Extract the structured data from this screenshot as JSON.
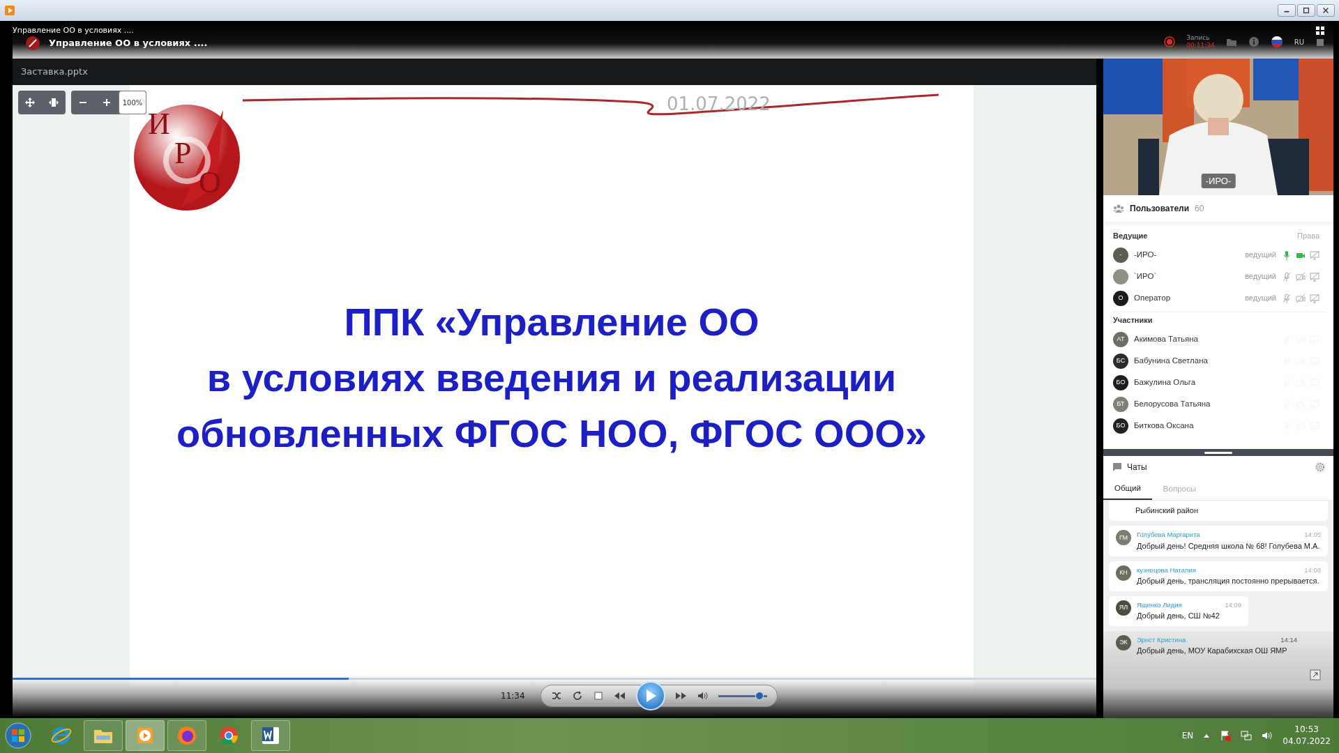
{
  "window": {
    "caption": "Управление ОО в условиях ...."
  },
  "header": {
    "title": "Управление ОО в условиях ....",
    "record_label": "Запись",
    "record_time": "00:11:34",
    "language": "RU"
  },
  "presentation": {
    "file": "Заставка.pptx",
    "zoom": "100%",
    "date": "01.07.2022",
    "logo_letters": [
      "И",
      "Р",
      "О"
    ],
    "title_lines": [
      "ППК «Управление ОО",
      "в условиях введения и реализации",
      "обновленных ФГОС НОО, ФГОС ООО»"
    ]
  },
  "video": {
    "kind": "picture",
    "caption": "-ИРО-"
  },
  "users": {
    "title": "Пользователи",
    "count": "60",
    "rights_label": "Права",
    "groups": [
      {
        "title": "Ведущие",
        "members": [
          {
            "initials": "-",
            "name": "-ИРО-",
            "role": "ведущий",
            "active": true,
            "mic": true,
            "cam": true,
            "color": "#5b5e50"
          },
          {
            "name": "`ИРО`",
            "role": "ведущий",
            "active": true,
            "mic": false,
            "cam": false,
            "color": "#8c9183"
          },
          {
            "initials": "О",
            "name": "Оператор",
            "role": "ведущий",
            "active": true,
            "mic": false,
            "cam": false,
            "color": "#1b1b1b"
          }
        ]
      },
      {
        "title": "Участники",
        "members": [
          {
            "initials": "АТ",
            "name": "Акимова Татьяна",
            "active": false,
            "mic": false,
            "cam": false,
            "color": "#6b6f62"
          },
          {
            "initials": "БС",
            "name": "Бабунина Светлана",
            "active": false,
            "mic": false,
            "cam": false,
            "color": "#2b2b2b"
          },
          {
            "initials": "БО",
            "name": "Бажулина Ольга",
            "active": false,
            "mic": false,
            "cam": false,
            "color": "#1e1e1e"
          },
          {
            "initials": "БТ",
            "name": "Белорусова Татьяна",
            "active": false,
            "mic": false,
            "cam": false,
            "color": "#7d8274"
          },
          {
            "initials": "БО",
            "name": "Биткова Оксана",
            "active": false,
            "mic": false,
            "cam": false,
            "color": "#222222"
          }
        ]
      }
    ]
  },
  "chat": {
    "title": "Чаты",
    "tabs": [
      {
        "label": "Общий",
        "selected": true
      },
      {
        "label": "Вопросы",
        "selected": false
      }
    ],
    "messages": [
      {
        "kind": "partial",
        "text": "Рыбинский район"
      },
      {
        "kind": "full",
        "initials": "ГМ",
        "author": "Голубева Маргарита",
        "time": "14:05",
        "text": "Добрый день! Средняя школа № 68! Голубева М.А.",
        "color": "#7a7e70"
      },
      {
        "kind": "full",
        "initials": "КН",
        "author": "кузнецова Наталия",
        "time": "14:08",
        "text": "Добрый день, трансляция постоянно прерывается.",
        "color": "#6b6f60"
      },
      {
        "kind": "short",
        "initials": "ЯЛ",
        "author": "Ященко Лидия",
        "time": "14:09",
        "text": "Добрый день, СШ №42",
        "color": "#4a4d40"
      },
      {
        "kind": "overlay",
        "initials": "ЭК",
        "author": "Эрнст Кристина",
        "time": "14:14",
        "text": "Добрый день, МОУ Карабихская ОШ ЯМР",
        "color": "#5a5d50"
      }
    ]
  },
  "player": {
    "time": "11:34",
    "progress": {
      "level": 0.31
    },
    "volume": {
      "level": 0.85
    }
  },
  "taskbar": {
    "apps": [
      {
        "kind": "ie",
        "running": false,
        "selected": false
      },
      {
        "kind": "explorer",
        "running": true,
        "selected": false
      },
      {
        "kind": "media",
        "running": true,
        "selected": true
      },
      {
        "kind": "firefox",
        "running": true,
        "selected": false
      },
      {
        "kind": "chrome",
        "running": false,
        "selected": false
      },
      {
        "kind": "word",
        "running": true,
        "selected": false
      }
    ],
    "language": "EN",
    "time": "10:53",
    "date": "04.07.2022"
  }
}
